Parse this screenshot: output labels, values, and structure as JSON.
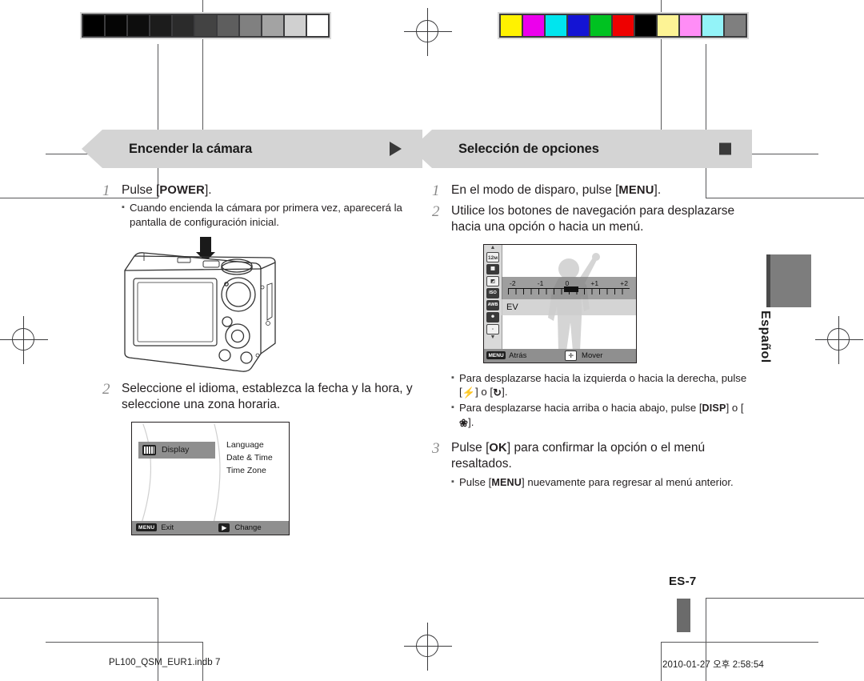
{
  "document": {
    "language_tab": "Español",
    "page_number": "ES-7",
    "footer_left": "PL100_QSM_EUR1.indb   7",
    "footer_right": "2010-01-27   오후 2:58:54"
  },
  "calibration": {
    "grayscale_label": "grayscale-strip",
    "grayscale_swatches": [
      "#000000",
      "#050505",
      "#0d0d0d",
      "#1c1c1c",
      "#2b2b2b",
      "#434343",
      "#5e5e5e",
      "#808080",
      "#a3a3a3",
      "#d0d0d0",
      "#ffffff"
    ],
    "color_label": "color-strip",
    "color_swatches": [
      "#fff200",
      "#ec00ec",
      "#00e5ee",
      "#1414d4",
      "#00c221",
      "#ee0000",
      "#000000",
      "#fdf395",
      "#ff8df6",
      "#93f3f8",
      "#7f7f7f"
    ]
  },
  "left_column": {
    "heading": "Encender la cámara",
    "marker": "triangle-marker",
    "steps": [
      {
        "num": "1",
        "text_before": "Pulse [",
        "key": "POWER",
        "text_after": "].",
        "bullets": [
          "Cuando encienda la cámara por primera vez, aparecerá la pantalla de configuración inicial."
        ]
      },
      {
        "num": "2",
        "text": "Seleccione el idioma, establezca la fecha y la hora, y seleccione una zona horaria."
      }
    ],
    "camera_figure": {
      "name": "camera-rear-illustration",
      "arrow": "power-button-arrow"
    },
    "lcd_settings": {
      "highlight_label": "Display",
      "highlight_icon": "display-icon",
      "options": [
        "Language",
        "Date & Time",
        "Time Zone"
      ],
      "footer_menu_badge": "MENU",
      "footer_left_text": "Exit",
      "footer_arrow_glyph": "▶",
      "footer_right_text": "Change"
    }
  },
  "right_column": {
    "heading": "Selección de opciones",
    "marker": "square-marker",
    "steps": [
      {
        "num": "1",
        "text_before": "En el modo de disparo, pulse [",
        "key": "MENU",
        "text_after": "]."
      },
      {
        "num": "2",
        "text": "Utilice los botones de navegación para desplazarse hacia una opción o hacia un menú."
      },
      {
        "num": "3",
        "text_before": "Pulse [",
        "key": "OK",
        "text_after": "] para confirmar la opción o el menú resaltados.",
        "bullets": [
          {
            "text_before": "Pulse [",
            "key": "MENU",
            "text_after": "] nuevamente para regresar al menú anterior."
          }
        ]
      }
    ],
    "bullets_nav": [
      {
        "text_before": "Para desplazarse hacia la izquierda o hacia la derecha, pulse [",
        "glyph1": "⚡",
        "mid": "] o [",
        "glyph2": "↻",
        "text_after": "]."
      },
      {
        "text_before": "Para desplazarse hacia arriba o hacia abajo, pulse [",
        "key1": "DISP",
        "mid": "] o [",
        "glyph2": "❀",
        "text_after": "]."
      }
    ],
    "lcd_ev": {
      "sidebar_icons": [
        "12M",
        "raw-icon",
        "ev-icon",
        "iso-auto-icon",
        "wb-icon",
        "face-off-icon",
        "plus-icon"
      ],
      "scale_ticks": [
        "-2",
        "-1",
        "0",
        "+1",
        "+2"
      ],
      "ev_label": "EV",
      "footer_menu_badge": "MENU",
      "footer_left_text": "Atrás",
      "footer_nav_glyph": "✛",
      "footer_right_text": "Mover"
    }
  }
}
